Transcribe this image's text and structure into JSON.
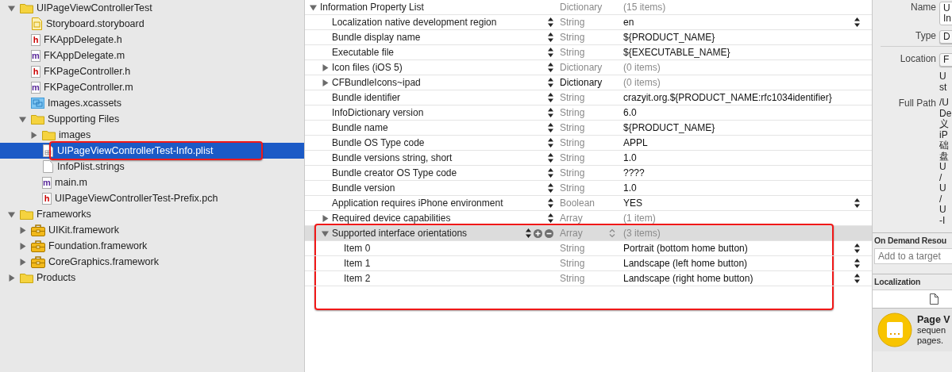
{
  "navigator": {
    "items": [
      {
        "label": "UIPageViewControllerTest",
        "kind": "folder",
        "expanded": true,
        "selected": false,
        "highlighted": false,
        "children": [
          {
            "label": "Storyboard.storyboard",
            "kind": "storyboard",
            "selected": false,
            "highlighted": false
          },
          {
            "label": "FKAppDelegate.h",
            "kind": "source",
            "letter": "h",
            "selected": false,
            "highlighted": false
          },
          {
            "label": "FKAppDelegate.m",
            "kind": "source",
            "letter": "m",
            "selected": false,
            "highlighted": false
          },
          {
            "label": "FKPageController.h",
            "kind": "source",
            "letter": "h",
            "selected": false,
            "highlighted": false
          },
          {
            "label": "FKPageController.m",
            "kind": "source",
            "letter": "m",
            "selected": false,
            "highlighted": false
          },
          {
            "label": "Images.xcassets",
            "kind": "assets",
            "selected": false,
            "highlighted": false
          },
          {
            "label": "Supporting Files",
            "kind": "folder",
            "expanded": true,
            "selected": false,
            "highlighted": false,
            "children": [
              {
                "label": "images",
                "kind": "folder",
                "expanded": false,
                "selected": false,
                "highlighted": false
              },
              {
                "label": "UIPageViewControllerTest-Info.plist",
                "kind": "plist",
                "selected": true,
                "highlighted": true
              },
              {
                "label": "InfoPlist.strings",
                "kind": "plain",
                "selected": false,
                "highlighted": false
              },
              {
                "label": "main.m",
                "kind": "source",
                "letter": "m",
                "selected": false,
                "highlighted": false
              },
              {
                "label": "UIPageViewControllerTest-Prefix.pch",
                "kind": "source",
                "letter": "h",
                "selected": false,
                "highlighted": false
              }
            ]
          }
        ]
      },
      {
        "label": "Frameworks",
        "kind": "folder",
        "expanded": true,
        "selected": false,
        "highlighted": false,
        "children": [
          {
            "label": "UIKit.framework",
            "kind": "framework",
            "expanded": false,
            "selected": false,
            "highlighted": false
          },
          {
            "label": "Foundation.framework",
            "kind": "framework",
            "expanded": false,
            "selected": false,
            "highlighted": false
          },
          {
            "label": "CoreGraphics.framework",
            "kind": "framework",
            "expanded": false,
            "selected": false,
            "highlighted": false
          }
        ]
      },
      {
        "label": "Products",
        "kind": "folder",
        "expanded": false,
        "selected": false,
        "highlighted": false
      }
    ]
  },
  "plist": {
    "rows": [
      {
        "key": "Information Property List",
        "type": "Dictionary",
        "value": "(15 items)",
        "expanded": true,
        "selected": false,
        "highlighted": false,
        "type_dimmed": true,
        "value_dimmed": true,
        "stepper": false,
        "value_popup": false,
        "children": [
          {
            "key": "Localization native development region",
            "type": "String",
            "value": "en",
            "selected": false,
            "highlighted": false,
            "type_dimmed": true,
            "value_dimmed": false,
            "stepper": true,
            "value_popup": true
          },
          {
            "key": "Bundle display name",
            "type": "String",
            "value": "${PRODUCT_NAME}",
            "selected": false,
            "highlighted": false,
            "type_dimmed": true,
            "value_dimmed": false,
            "stepper": true,
            "value_popup": false
          },
          {
            "key": "Executable file",
            "type": "String",
            "value": "${EXECUTABLE_NAME}",
            "selected": false,
            "highlighted": false,
            "type_dimmed": true,
            "value_dimmed": false,
            "stepper": true,
            "value_popup": false
          },
          {
            "key": "Icon files (iOS 5)",
            "type": "Dictionary",
            "value": "(0 items)",
            "expanded": false,
            "selected": false,
            "highlighted": false,
            "type_dimmed": true,
            "value_dimmed": true,
            "stepper": true,
            "value_popup": false
          },
          {
            "key": "CFBundleIcons~ipad",
            "type": "Dictionary",
            "value": "(0 items)",
            "expanded": false,
            "selected": false,
            "highlighted": false,
            "type_dimmed": false,
            "value_dimmed": true,
            "stepper": true,
            "value_popup": false
          },
          {
            "key": "Bundle identifier",
            "type": "String",
            "value": "crazyit.org.${PRODUCT_NAME:rfc1034identifier}",
            "selected": false,
            "highlighted": false,
            "type_dimmed": true,
            "value_dimmed": false,
            "stepper": true,
            "value_popup": false
          },
          {
            "key": "InfoDictionary version",
            "type": "String",
            "value": "6.0",
            "selected": false,
            "highlighted": false,
            "type_dimmed": true,
            "value_dimmed": false,
            "stepper": true,
            "value_popup": false
          },
          {
            "key": "Bundle name",
            "type": "String",
            "value": "${PRODUCT_NAME}",
            "selected": false,
            "highlighted": false,
            "type_dimmed": true,
            "value_dimmed": false,
            "stepper": true,
            "value_popup": false
          },
          {
            "key": "Bundle OS Type code",
            "type": "String",
            "value": "APPL",
            "selected": false,
            "highlighted": false,
            "type_dimmed": true,
            "value_dimmed": false,
            "stepper": true,
            "value_popup": false
          },
          {
            "key": "Bundle versions string, short",
            "type": "String",
            "value": "1.0",
            "selected": false,
            "highlighted": false,
            "type_dimmed": true,
            "value_dimmed": false,
            "stepper": true,
            "value_popup": false
          },
          {
            "key": "Bundle creator OS Type code",
            "type": "String",
            "value": "????",
            "selected": false,
            "highlighted": false,
            "type_dimmed": true,
            "value_dimmed": false,
            "stepper": true,
            "value_popup": false
          },
          {
            "key": "Bundle version",
            "type": "String",
            "value": "1.0",
            "selected": false,
            "highlighted": false,
            "type_dimmed": true,
            "value_dimmed": false,
            "stepper": true,
            "value_popup": false
          },
          {
            "key": "Application requires iPhone environment",
            "type": "Boolean",
            "value": "YES",
            "selected": false,
            "highlighted": false,
            "type_dimmed": true,
            "value_dimmed": false,
            "stepper": true,
            "value_popup": true
          },
          {
            "key": "Required device capabilities",
            "type": "Array",
            "value": "(1 item)",
            "expanded": false,
            "selected": false,
            "highlighted": false,
            "type_dimmed": true,
            "value_dimmed": true,
            "stepper": true,
            "value_popup": false
          },
          {
            "key": "Supported interface orientations",
            "type": "Array",
            "value": "(3 items)",
            "expanded": true,
            "selected": true,
            "highlighted": true,
            "type_dimmed": true,
            "value_dimmed": true,
            "stepper": true,
            "value_popup": false,
            "children": [
              {
                "key": "Item 0",
                "type": "String",
                "value": "Portrait (bottom home button)",
                "selected": false,
                "highlighted": false,
                "type_dimmed": true,
                "value_dimmed": false,
                "stepper": false,
                "value_popup": true
              },
              {
                "key": "Item 1",
                "type": "String",
                "value": "Landscape (left home button)",
                "selected": false,
                "highlighted": false,
                "type_dimmed": true,
                "value_dimmed": false,
                "stepper": false,
                "value_popup": true
              },
              {
                "key": "Item 2",
                "type": "String",
                "value": "Landscape (right home button)",
                "selected": false,
                "highlighted": false,
                "type_dimmed": true,
                "value_dimmed": false,
                "stepper": false,
                "value_popup": true
              }
            ]
          }
        ]
      }
    ]
  },
  "inspector": {
    "identity": [
      {
        "label": "Name",
        "kind": "field",
        "lines": [
          "U",
          "In"
        ]
      },
      {
        "label": "Type",
        "kind": "popup",
        "lines": [
          "D"
        ]
      }
    ],
    "location": [
      {
        "label": "Location",
        "kind": "popup",
        "lines": [
          "F"
        ]
      },
      {
        "kind": "text",
        "lines": [
          "U",
          "st"
        ]
      },
      {
        "label": "Full Path",
        "kind": "text",
        "lines": [
          "/U",
          "De",
          "义",
          "iP",
          "础",
          "盘",
          "U",
          "/",
          "U",
          "/",
          "U",
          "-I"
        ]
      }
    ],
    "on_demand": {
      "title": "On Demand Resou",
      "placeholder": "Add to a target"
    },
    "localization": {
      "title": "Localization"
    },
    "library_item": {
      "title": "Page V",
      "lines": [
        "sequen",
        "pages."
      ]
    }
  }
}
